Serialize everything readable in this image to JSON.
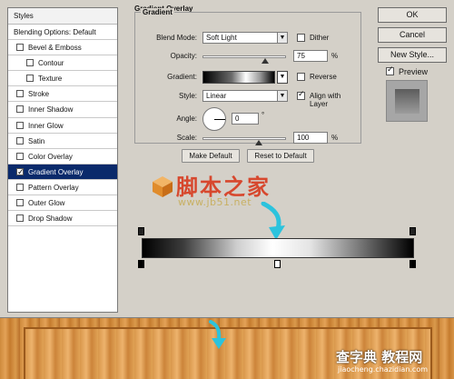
{
  "dialog": {
    "styles_list": {
      "header": "Styles",
      "items": [
        {
          "label": "Blending Options: Default",
          "checkbox": false,
          "checked": false,
          "sub": false,
          "selected": false
        },
        {
          "label": "Bevel & Emboss",
          "checkbox": true,
          "checked": false,
          "sub": false,
          "selected": false
        },
        {
          "label": "Contour",
          "checkbox": true,
          "checked": false,
          "sub": true,
          "selected": false
        },
        {
          "label": "Texture",
          "checkbox": true,
          "checked": false,
          "sub": true,
          "selected": false
        },
        {
          "label": "Stroke",
          "checkbox": true,
          "checked": false,
          "sub": false,
          "selected": false
        },
        {
          "label": "Inner Shadow",
          "checkbox": true,
          "checked": false,
          "sub": false,
          "selected": false
        },
        {
          "label": "Inner Glow",
          "checkbox": true,
          "checked": false,
          "sub": false,
          "selected": false
        },
        {
          "label": "Satin",
          "checkbox": true,
          "checked": false,
          "sub": false,
          "selected": false
        },
        {
          "label": "Color Overlay",
          "checkbox": true,
          "checked": false,
          "sub": false,
          "selected": false
        },
        {
          "label": "Gradient Overlay",
          "checkbox": true,
          "checked": true,
          "sub": false,
          "selected": true
        },
        {
          "label": "Pattern Overlay",
          "checkbox": true,
          "checked": false,
          "sub": false,
          "selected": false
        },
        {
          "label": "Outer Glow",
          "checkbox": true,
          "checked": false,
          "sub": false,
          "selected": false
        },
        {
          "label": "Drop Shadow",
          "checkbox": true,
          "checked": false,
          "sub": false,
          "selected": false
        }
      ]
    },
    "panel": {
      "title": "Gradient Overlay",
      "group_title": "Gradient",
      "blend_mode_label": "Blend Mode:",
      "blend_mode_value": "Soft Light",
      "dither_label": "Dither",
      "dither_checked": false,
      "opacity_label": "Opacity:",
      "opacity_value": "75",
      "opacity_fraction": 0.75,
      "percent_sign": "%",
      "gradient_label": "Gradient:",
      "reverse_label": "Reverse",
      "reverse_checked": false,
      "style_label": "Style:",
      "style_value": "Linear",
      "align_label": "Align with Layer",
      "align_checked": true,
      "angle_label": "Angle:",
      "angle_value": "0",
      "degree_sign": "°",
      "scale_label": "Scale:",
      "scale_value": "100",
      "scale_fraction": 0.67,
      "make_default": "Make Default",
      "reset_default": "Reset to Default"
    },
    "buttons": {
      "ok": "OK",
      "cancel": "Cancel",
      "new_style": "New Style...",
      "preview_label": "Preview",
      "preview_checked": true
    }
  },
  "gradient_editor": {
    "colors": [
      "#000000",
      "#3c3c3c",
      "#cfcfcf",
      "#ffffff",
      "#e4e4e4",
      "#6d6d6d",
      "#000000"
    ]
  },
  "watermark": {
    "title": "脚本之家",
    "url": "www.jb51.net",
    "bottom_title": "查字典 教程网",
    "bottom_url": "jiaocheng.chazidian.com"
  },
  "colors": {
    "selection": "#0a2a6b",
    "arrow": "#2cc3dd",
    "wood": "#d9974b"
  }
}
